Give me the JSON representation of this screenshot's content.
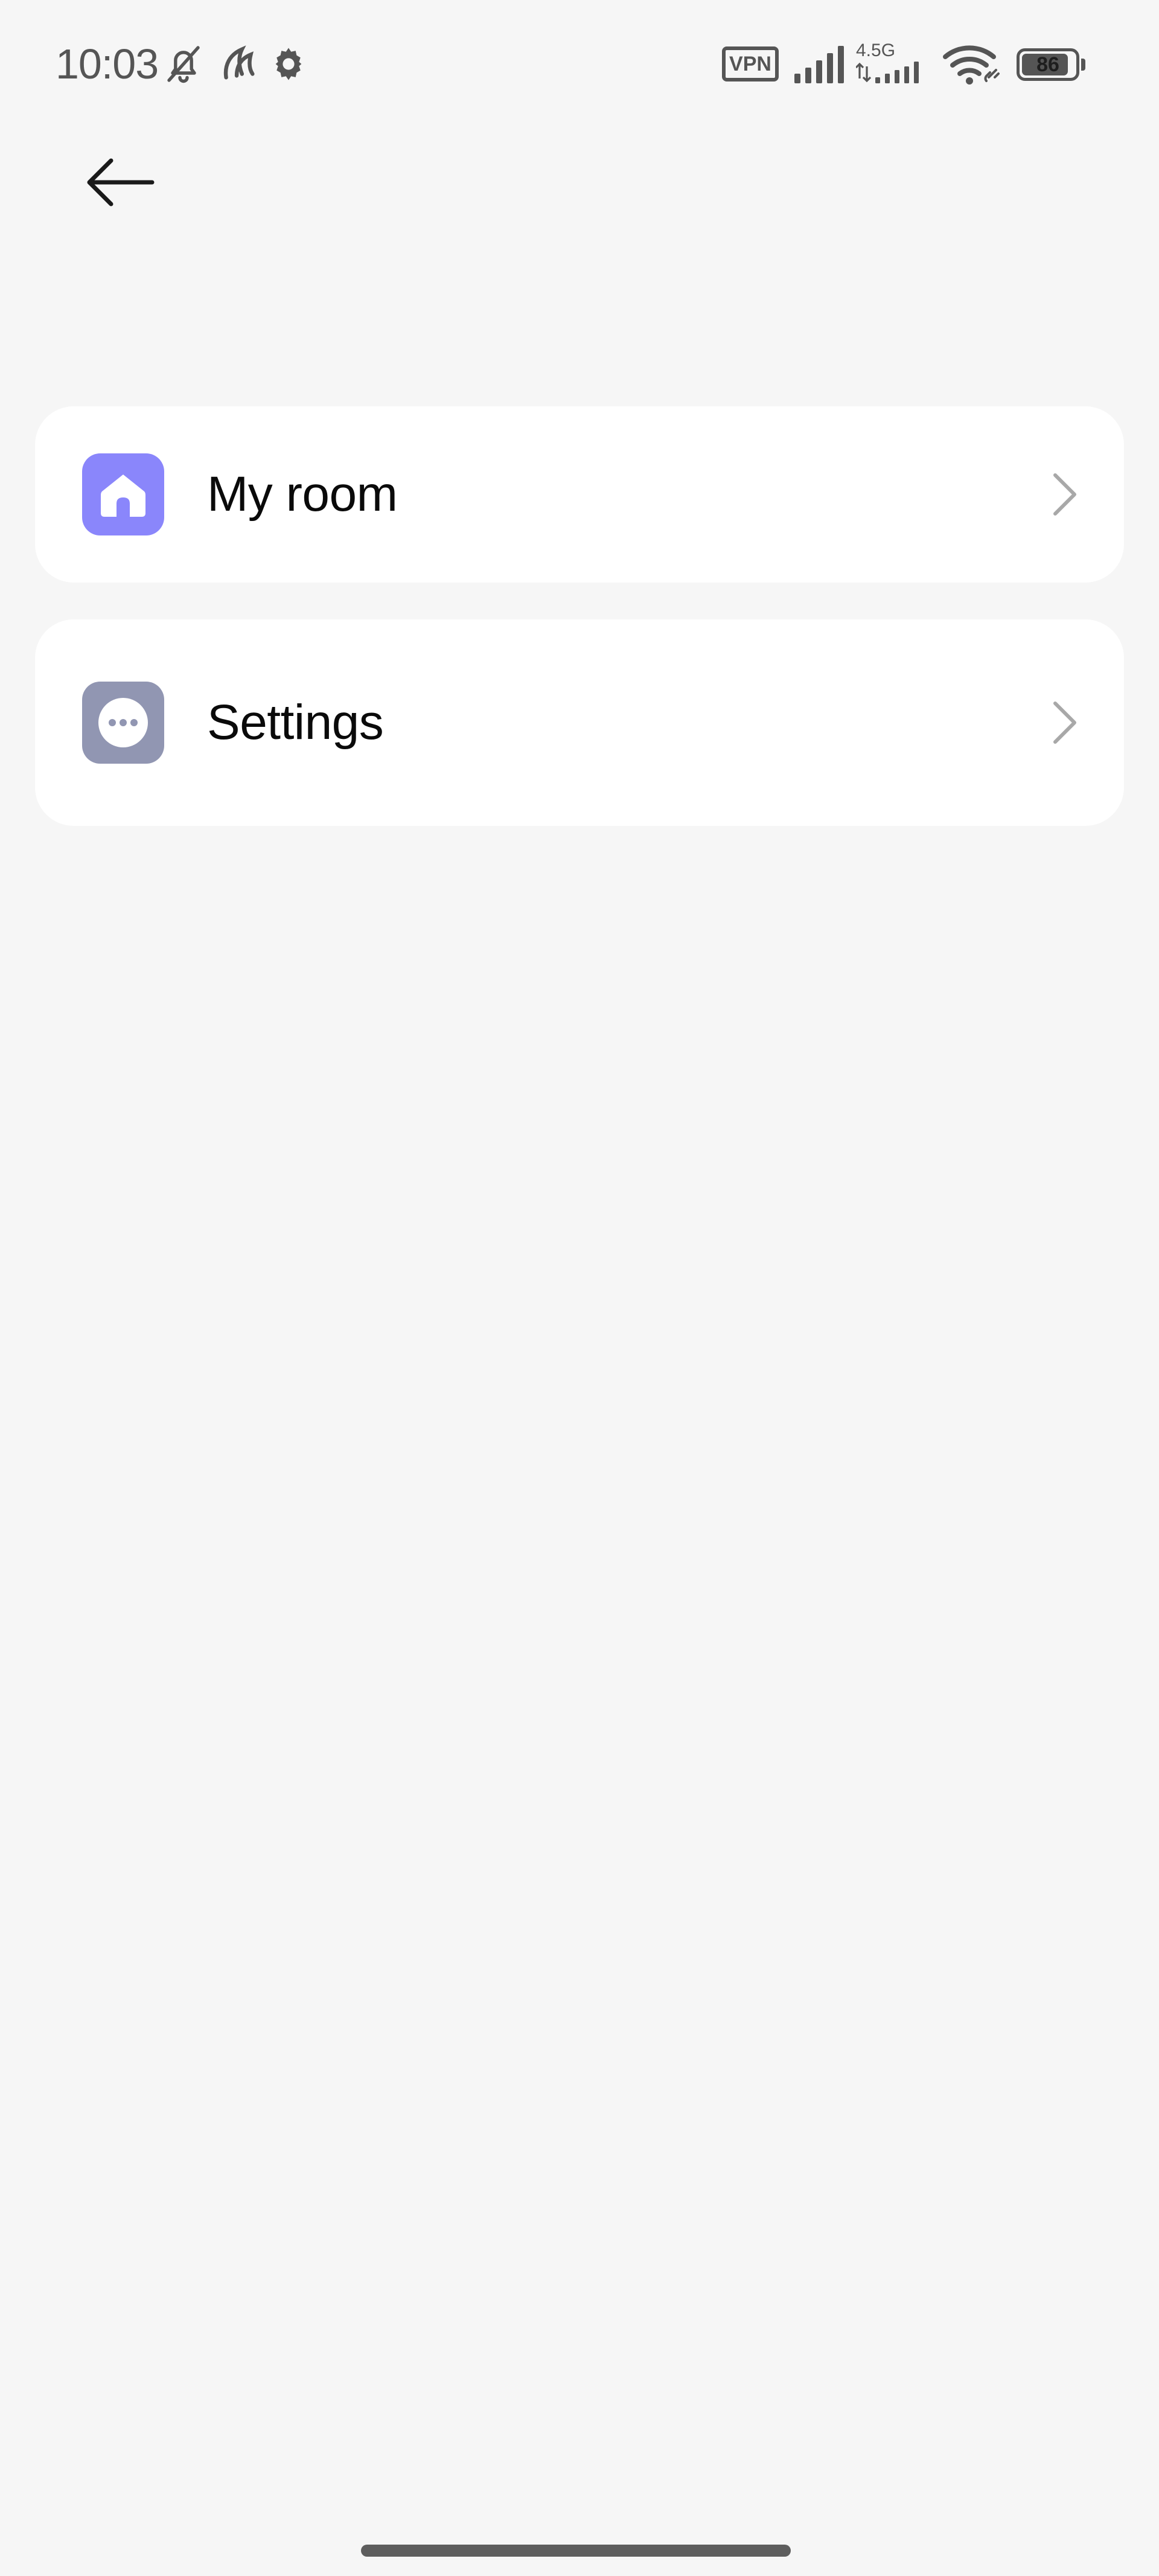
{
  "status_bar": {
    "time": "10:03",
    "left_icons": [
      "bell-muted-icon",
      "leaf-app-icon",
      "gear-icon"
    ],
    "vpn_label": "VPN",
    "network_type": "4.5G",
    "battery_level": "86",
    "right_icons": [
      "vpn-badge-icon",
      "signal-icon",
      "signal-4g-icon",
      "wifi-icon",
      "battery-icon"
    ]
  },
  "top_bar": {
    "back_icon": "arrow-left-icon"
  },
  "menu": {
    "items": [
      {
        "label": "My room",
        "icon": "home-icon",
        "icon_color": "#8a86fb",
        "trailing_icon": "chevron-right-icon"
      },
      {
        "label": "Settings",
        "icon": "more-dots-icon",
        "icon_color": "#9196b2",
        "trailing_icon": "chevron-right-icon"
      }
    ]
  },
  "colors": {
    "background": "#f6f6f6",
    "card": "#ffffff",
    "text": "#0a0a0a",
    "status_text": "#555555",
    "chevron": "#a8a8a8"
  }
}
